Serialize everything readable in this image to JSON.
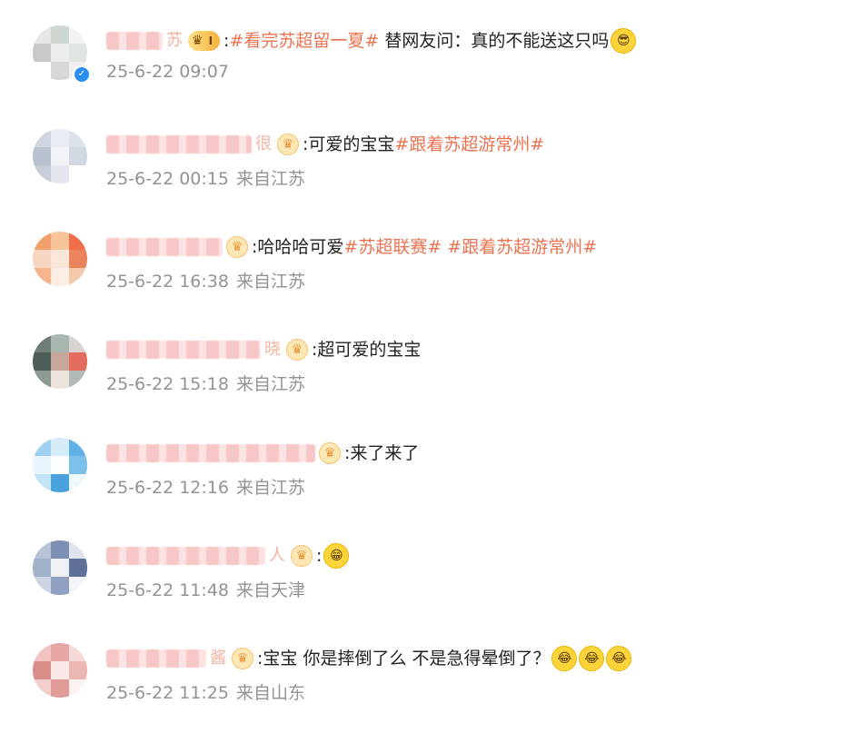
{
  "comments": [
    {
      "name_tail": "苏",
      "badge": {
        "type": "vip",
        "label": "I",
        "icon": "crown-icon"
      },
      "text_parts": [
        {
          "kind": "text",
          "value": ":"
        },
        {
          "kind": "topic",
          "value": "#看完苏超留一夏#"
        },
        {
          "kind": "text",
          "value": " 替网友问：真的不能送这只吗"
        }
      ],
      "emoji": [
        "😎"
      ],
      "time": "25-6-22 09:07",
      "location": "",
      "verified": true
    },
    {
      "name_tail": "很",
      "badge": {
        "type": "crown",
        "icon": "crown-icon"
      },
      "text_parts": [
        {
          "kind": "text",
          "value": ":可爱的宝宝"
        },
        {
          "kind": "topic",
          "value": "#跟着苏超游常州#"
        }
      ],
      "emoji": [],
      "time": "25-6-22 00:15",
      "location": "来自江苏",
      "verified": false
    },
    {
      "name_tail": "",
      "badge": {
        "type": "crown",
        "icon": "crown-icon"
      },
      "text_parts": [
        {
          "kind": "text",
          "value": ":哈哈哈可爱"
        },
        {
          "kind": "topic",
          "value": "#苏超联赛#"
        },
        {
          "kind": "text",
          "value": " "
        },
        {
          "kind": "topic",
          "value": "#跟着苏超游常州#"
        }
      ],
      "emoji": [],
      "time": "25-6-22 16:38",
      "location": "来自江苏",
      "verified": false
    },
    {
      "name_tail": "晓",
      "badge": {
        "type": "crown",
        "icon": "crown-icon"
      },
      "text_parts": [
        {
          "kind": "text",
          "value": ":超可爱的宝宝"
        }
      ],
      "emoji": [],
      "time": "25-6-22 15:18",
      "location": "来自江苏",
      "verified": false
    },
    {
      "name_tail": "",
      "badge": {
        "type": "crown",
        "icon": "crown-icon"
      },
      "text_parts": [
        {
          "kind": "text",
          "value": ":来了来了"
        }
      ],
      "emoji": [],
      "time": "25-6-22 12:16",
      "location": "来自江苏",
      "verified": false
    },
    {
      "name_tail": "人",
      "badge": {
        "type": "crown",
        "icon": "crown-icon"
      },
      "text_parts": [
        {
          "kind": "text",
          "value": ":"
        }
      ],
      "emoji": [
        "😁"
      ],
      "time": "25-6-22 11:48",
      "location": "来自天津",
      "verified": false
    },
    {
      "name_tail": "酱",
      "badge": {
        "type": "crown",
        "icon": "crown-icon"
      },
      "text_parts": [
        {
          "kind": "text",
          "value": ":宝宝 你是摔倒了么 不是急得晕倒了？"
        }
      ],
      "emoji": [
        "😂",
        "😂",
        "😂"
      ],
      "time": "25-6-22 11:25",
      "location": "来自山东",
      "verified": false
    }
  ],
  "colors": {
    "topic": "#eb7350",
    "meta": "#939393",
    "text": "#222222"
  }
}
